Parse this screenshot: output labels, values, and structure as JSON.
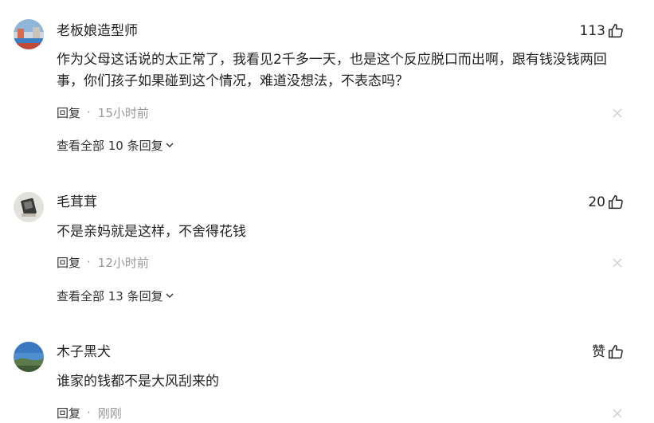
{
  "comments": [
    {
      "username": "老板娘造型师",
      "like_count": "113",
      "content": "作为父母这话说的太正常了，我看见2千多一天，也是这个反应脱口而出啊，跟有钱没钱两回事，你们孩子如果碰到这个情况，难道没想法，不表态吗？",
      "reply_label": "回复",
      "time": "15小时前",
      "view_replies": "查看全部 10 条回复"
    },
    {
      "username": "毛茸茸",
      "like_count": "20",
      "content": "不是亲妈就是这样，不舍得花钱",
      "reply_label": "回复",
      "time": "12小时前",
      "view_replies": "查看全部 13 条回复"
    },
    {
      "username": "木子黑犬",
      "like_count": "赞",
      "content": "谁家的钱都不是大风刮来的",
      "reply_label": "回复",
      "time": "刚刚"
    }
  ],
  "separator": "·",
  "icons": {
    "like": "thumbs-up-icon",
    "close": "close-icon",
    "expand": "chevron-down-icon"
  },
  "colors": {
    "text": "#222222",
    "muted": "#999999",
    "close": "#cccccc"
  }
}
